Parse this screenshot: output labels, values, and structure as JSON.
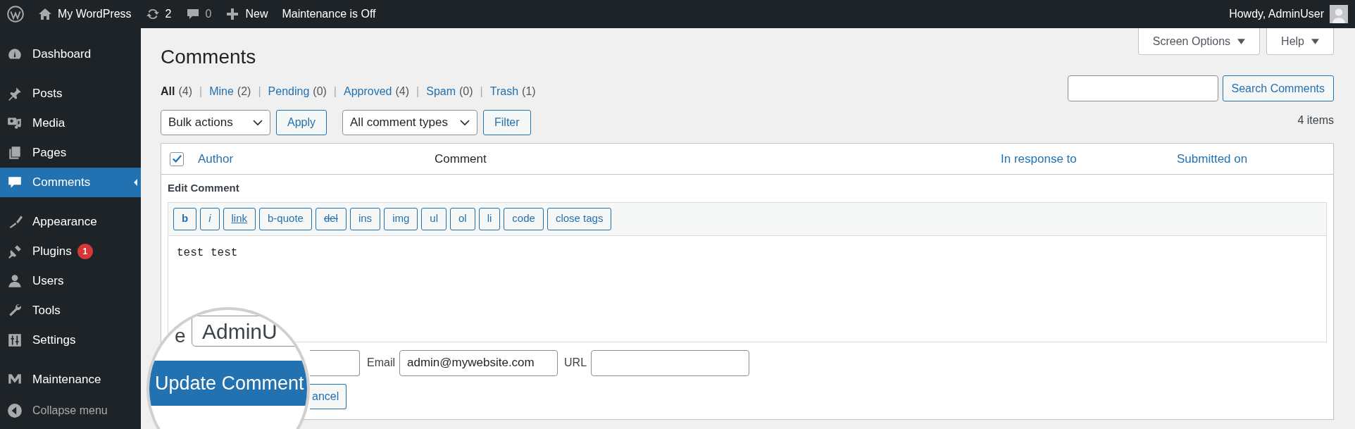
{
  "admin_bar": {
    "site": "My WordPress",
    "updates": "2",
    "comments": "0",
    "new": "New",
    "maintenance": "Maintenance is Off",
    "howdy": "Howdy, AdminUser"
  },
  "sidebar": {
    "sections": [
      [
        {
          "label": "Dashboard",
          "selected": false
        }
      ],
      [
        {
          "label": "Posts",
          "selected": false
        },
        {
          "label": "Media",
          "selected": false
        },
        {
          "label": "Pages",
          "selected": false
        },
        {
          "label": "Comments",
          "selected": true
        }
      ],
      [
        {
          "label": "Appearance",
          "selected": false
        },
        {
          "label": "Plugins",
          "selected": false,
          "badge": "1"
        },
        {
          "label": "Users",
          "selected": false
        },
        {
          "label": "Tools",
          "selected": false
        },
        {
          "label": "Settings",
          "selected": false
        }
      ],
      [
        {
          "label": "Maintenance",
          "selected": false
        }
      ]
    ],
    "collapse": "Collapse menu"
  },
  "page_title": "Comments",
  "screen_options": "Screen Options",
  "help": "Help",
  "views": [
    {
      "label": "All",
      "count": "(4)",
      "selected": true
    },
    {
      "separator": "|",
      "label": "Mine",
      "count": "(2)",
      "selected": false
    },
    {
      "separator": "|",
      "label": "Pending",
      "count": "(0)",
      "selected": false
    },
    {
      "separator": "|",
      "label": "Approved",
      "count": "(4)",
      "selected": false
    },
    {
      "separator": "|",
      "label": "Spam",
      "count": "(0)",
      "selected": false
    },
    {
      "separator": "|",
      "label": "Trash",
      "count": "(1)",
      "selected": false
    }
  ],
  "bulk_actions": "Bulk actions",
  "apply": "Apply",
  "comment_types": "All comment types",
  "filter": "Filter",
  "search_button": "Search Comments",
  "items_count": "4 items",
  "table": {
    "select_all_checked": true,
    "columns": [
      {
        "label": "Author",
        "sortable": true
      },
      {
        "label": "Comment",
        "sortable": false
      },
      {
        "label": "In response to",
        "sortable": true
      },
      {
        "label": "Submitted on",
        "sortable": true
      }
    ]
  },
  "edit_comment": {
    "title": "Edit Comment",
    "quicktags": [
      {
        "label": "b",
        "kind": "bold"
      },
      {
        "label": "i",
        "kind": "italic"
      },
      {
        "label": "link",
        "kind": "underline"
      },
      {
        "label": "b-quote",
        "kind": "plain"
      },
      {
        "label": "del",
        "kind": "strike"
      },
      {
        "label": "ins",
        "kind": "plain"
      },
      {
        "label": "img",
        "kind": "plain"
      },
      {
        "label": "ul",
        "kind": "plain"
      },
      {
        "label": "ol",
        "kind": "plain"
      },
      {
        "label": "li",
        "kind": "plain"
      },
      {
        "label": "code",
        "kind": "plain"
      },
      {
        "label": "close tags",
        "kind": "plain"
      }
    ],
    "text": "test test",
    "email_label": "Email",
    "email": "admin@mywebsite.com",
    "url_label": "URL",
    "cancel": "ancel"
  },
  "magnifier": {
    "label_fragment": "e",
    "name_value": "AdminU",
    "update_button": "Update Comment"
  }
}
